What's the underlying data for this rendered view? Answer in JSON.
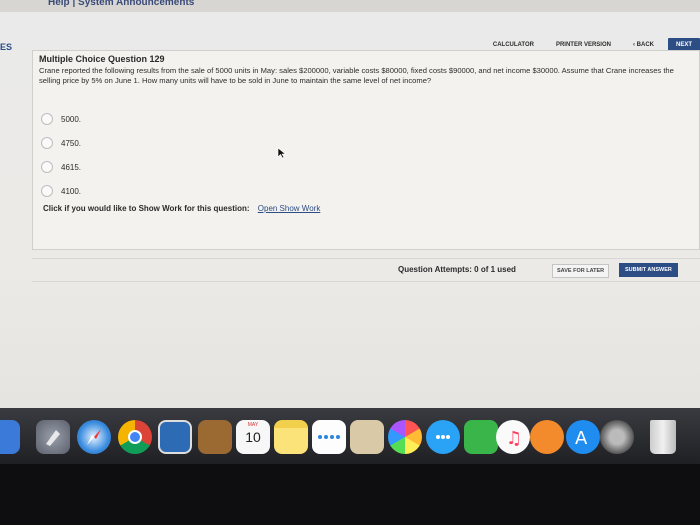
{
  "top": {
    "menu_text": "Help | System Announcements"
  },
  "sidebar": {
    "tag": "ES"
  },
  "toolbar": {
    "calculator": "CALCULATOR",
    "printer": "PRINTER VERSION",
    "back": "‹ BACK",
    "next": "NEXT"
  },
  "question": {
    "title": "Multiple Choice Question 129",
    "text": "Crane reported the following results from the sale of 5000 units in May: sales $200000, variable costs $80000, fixed costs $90000, and net income $30000. Assume that Crane increases the selling price by 5% on June 1. How many units will have to be sold in June to maintain the same level of net income?",
    "options": [
      "5000.",
      "4750.",
      "4615.",
      "4100."
    ],
    "show_work_prompt": "Click if you would like to Show Work for this question:",
    "show_work_link": "Open Show Work"
  },
  "footer": {
    "attempts": "Question Attempts: 0 of 1 used",
    "save_later": "SAVE FOR LATER",
    "submit": "SUBMIT ANSWER"
  },
  "dock": {
    "calendar_month": "MAY",
    "calendar_day": "10",
    "icons": [
      "finder-icon",
      "launchpad-icon",
      "safari-icon",
      "chrome-icon",
      "preview-icon",
      "notebook-icon",
      "calendar-icon",
      "notes-icon",
      "reminders-icon",
      "photo-viewer-icon",
      "photos-icon",
      "messages-icon",
      "facetime-icon",
      "music-icon",
      "books-icon",
      "app-store-icon",
      "system-preferences-icon",
      "trash-icon"
    ]
  }
}
